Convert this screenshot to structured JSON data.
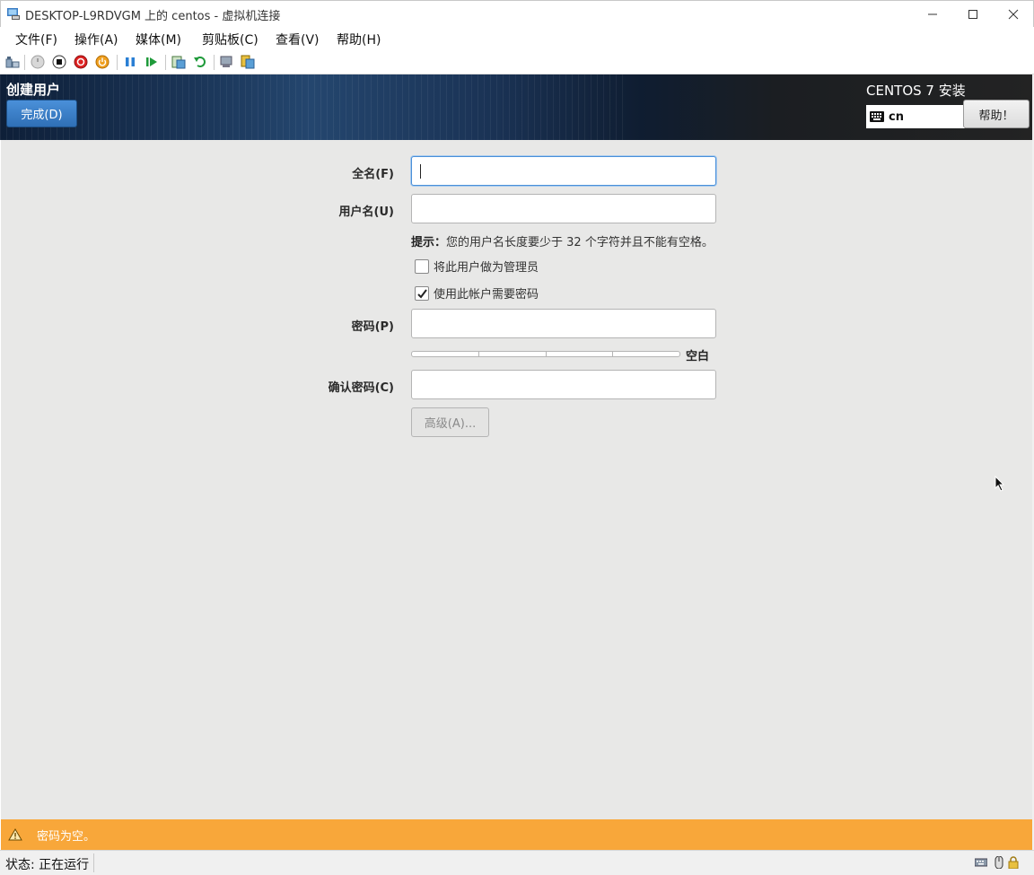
{
  "window": {
    "title": "DESKTOP-L9RDVGM 上的 centos - 虚拟机连接"
  },
  "menu": [
    {
      "label": "文件(F)"
    },
    {
      "label": "操作(A)"
    },
    {
      "label": "媒体(M)"
    },
    {
      "label": "剪贴板(C)"
    },
    {
      "label": "查看(V)"
    },
    {
      "label": "帮助(H)"
    }
  ],
  "header": {
    "spoke_title": "创建用户",
    "done_label": "完成(D)",
    "product_title": "CENTOS 7 安装",
    "keyboard_layout": "cn",
    "help_label": "帮助！"
  },
  "form": {
    "fullname_label": "全名(F)",
    "fullname_value": "",
    "username_label": "用户名(U)",
    "username_value": "",
    "hint_bold": "提示：",
    "hint_text": "您的用户名长度要少于 32 个字符并且不能有空格。",
    "admin_label": "将此用户做为管理员",
    "admin_checked": false,
    "require_password_label": "使用此帐户需要密码",
    "require_password_checked": true,
    "password_label": "密码(P)",
    "password_value": "",
    "strength_label": "空白",
    "confirm_label": "确认密码(C)",
    "confirm_value": "",
    "advanced_label": "高级(A)..."
  },
  "warning": {
    "text": "密码为空。",
    "color": "#f8a73a"
  },
  "status": {
    "text": "状态: 正在运行"
  },
  "colors": {
    "accent": "#4a90d9",
    "content_bg": "#e8e8e7"
  }
}
